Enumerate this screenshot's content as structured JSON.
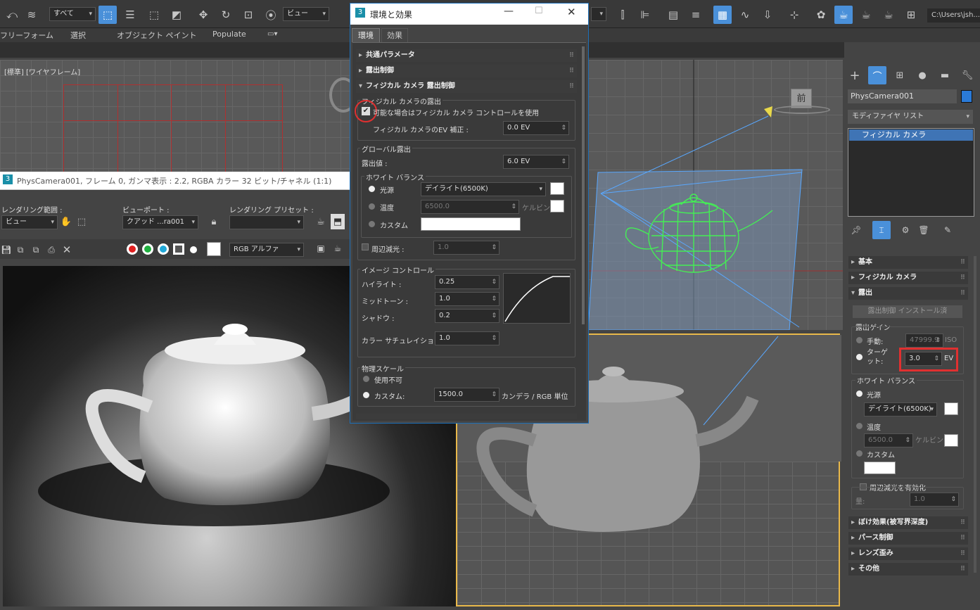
{
  "toolbar": {
    "selection_filter": "すべて",
    "ref_coord": "ビュー",
    "path_text": "C:\\Users\\jsh..."
  },
  "menu": {
    "freeform": "フリーフォーム",
    "selection": "選択",
    "object_paint": "オブジェクト ペイント",
    "populate": "Populate"
  },
  "top_viewport": {
    "label": "[標準] [ワイヤフレーム]",
    "front_label": "前"
  },
  "render_frame": {
    "title": "PhysCamera001, フレーム 0, ガンマ表示 : 2.2, RGBA カラー 32 ビット/チャネル (1:1)",
    "render_range_label": "レンダリング範囲 :",
    "render_range_value": "ビュー",
    "viewport_label": "ビューポート :",
    "viewport_value": "クアッド ...ra001",
    "preset_label": "レンダリング プリセット :",
    "preset_value": "",
    "channel_value": "RGB アルファ"
  },
  "dialog": {
    "title": "環境と効果",
    "tab_env": "環境",
    "tab_effects": "効果",
    "rollout_common": "共通パラメータ",
    "rollout_exposure": "露出制御",
    "rollout_physcam": "フィジカル カメラ 露出制御",
    "group_physcam": "フィジカル カメラの露出",
    "use_physcam": "可能な場合はフィジカル カメラ コントロールを使用",
    "ev_comp_label": "フィジカル カメラのEV 補正 :",
    "ev_comp_value": "0.0 EV",
    "group_global": "グローバル露出",
    "exposure_label": "露出値 :",
    "exposure_value": "6.0 EV",
    "group_wb": "ホワイト バランス",
    "wb_illuminant": "光源",
    "wb_illuminant_value": "デイライト(6500K)",
    "wb_temp": "温度",
    "wb_temp_value": "6500.0",
    "wb_kelvin": "ケルビン",
    "wb_custom": "カスタム",
    "vignette_label": "周辺減光 :",
    "vignette_value": "1.0",
    "group_image": "イメージ コントロール",
    "highlight_label": "ハイライト :",
    "highlight_value": "0.25",
    "midtone_label": "ミッドトーン :",
    "midtone_value": "1.0",
    "shadow_label": "シャドウ :",
    "shadow_value": "0.2",
    "saturation_label": "カラー サチュレイション :",
    "saturation_value": "1.0",
    "group_physscale": "物理スケール",
    "disable_label": "使用不可",
    "custom_label": "カスタム:",
    "custom_value": "1500.0",
    "custom_unit": "カンデラ / RGB 単位"
  },
  "right_panel": {
    "object_name": "PhysCamera001",
    "modifier_list": "モディファイヤ リスト",
    "stack_item": "フィジカル カメラ",
    "sec_basic": "基本",
    "sec_physcam": "フィジカル カメラ",
    "sec_exposure": "露出",
    "install_btn": "露出制御 インストール済",
    "exposure_gain": "露出ゲイン",
    "manual_label": "手動:",
    "manual_value": "47999.9",
    "iso_label": "ISO",
    "target_label": "ターゲット:",
    "target_value": "3.0",
    "ev_label": "EV",
    "wb_group": "ホワイト バランス",
    "illuminant": "光源",
    "illuminant_value": "デイライト(6500K)",
    "temp": "温度",
    "temp_value": "6500.0",
    "kelvin": "ケルビン",
    "custom": "カスタム",
    "vignette_enable": "周辺減光を有効化",
    "amount_label": "量:",
    "amount_value": "1.0",
    "sec_dof": "ぼけ効果(被写界深度)",
    "sec_perspective": "パース制御",
    "sec_lens": "レンズ歪み",
    "sec_misc": "その他"
  },
  "colors": {
    "accent": "#4a90d9",
    "wire": "#44ee55",
    "highlight_box": "#e03030"
  }
}
